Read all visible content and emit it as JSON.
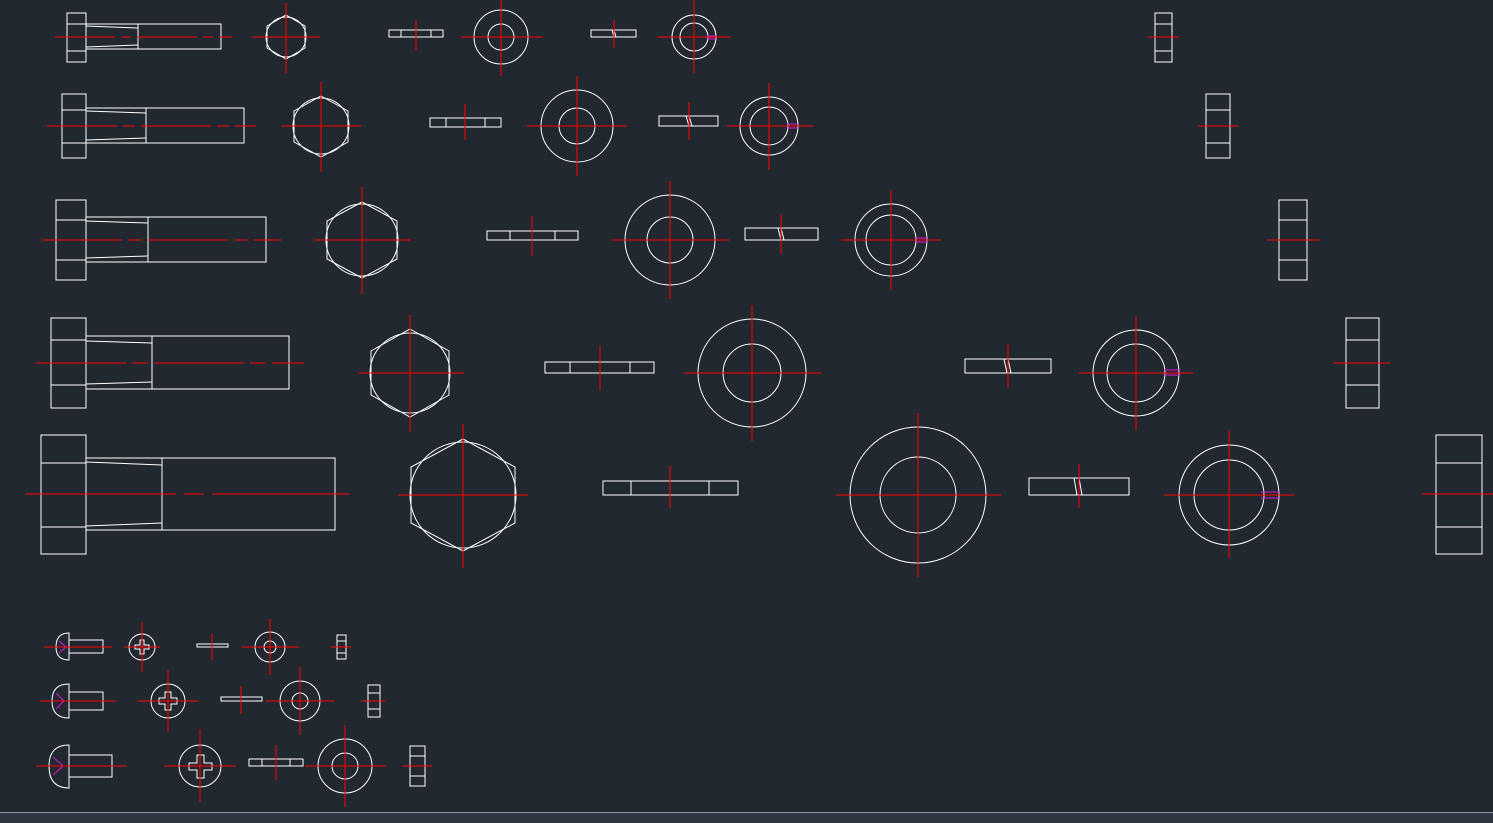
{
  "colors": {
    "background": "#212830",
    "geometry": "#ffffff",
    "centerline": "#ff0000",
    "highlight": "#d61ad6",
    "status_strip": "#2e3641"
  },
  "drawing": {
    "bolt_sets": [
      "size-1",
      "size-2",
      "size-3",
      "size-4",
      "size-5"
    ],
    "screw_sets": [
      "screw-1",
      "screw-2",
      "screw-3"
    ]
  }
}
